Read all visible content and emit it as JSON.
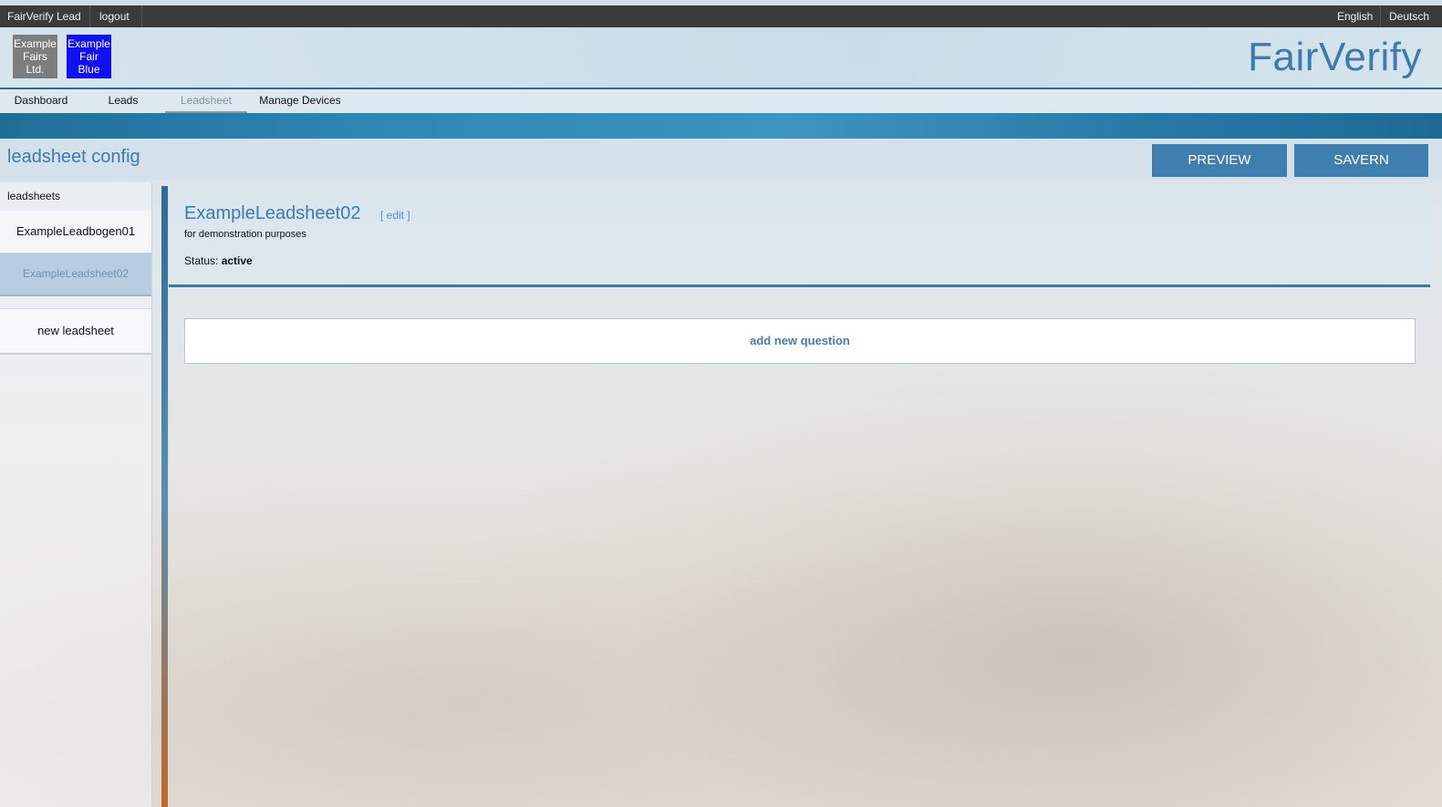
{
  "topbar": {
    "app_name": "FairVerify Lead",
    "logout": "logout",
    "lang_en": "English",
    "lang_de": "Deutsch"
  },
  "header": {
    "fairs": [
      {
        "line1": "Example",
        "line2": "Fairs",
        "line3": "Ltd."
      },
      {
        "line1": "Example",
        "line2": "Fair",
        "line3": "Blue"
      }
    ],
    "brand": "FairVerify"
  },
  "nav": {
    "tabs": [
      {
        "label": "Dashboard"
      },
      {
        "label": "Leads"
      },
      {
        "label": "Leadsheet"
      },
      {
        "label": "Manage Devices"
      }
    ]
  },
  "page": {
    "title": "leadsheet config",
    "preview_label": "PREVIEW",
    "save_label": "SAVERN"
  },
  "sidebar": {
    "heading": "leadsheets",
    "items": [
      {
        "label": "ExampleLeadbogen01"
      },
      {
        "label": "ExampleLeadsheet02"
      }
    ],
    "new_label": "new leadsheet"
  },
  "sheet": {
    "title": "ExampleLeadsheet02",
    "edit_label": "[ edit ]",
    "description": "for demonstration purposes",
    "status_label": "Status:",
    "status_value": "active",
    "add_question_label": "add new question"
  },
  "colors": {
    "accent": "#3d7aae",
    "button": "#3f7fb0",
    "topbar": "#3b3b3b",
    "fair_gray": "#7d7d7d",
    "fair_blue": "#1010f0"
  }
}
